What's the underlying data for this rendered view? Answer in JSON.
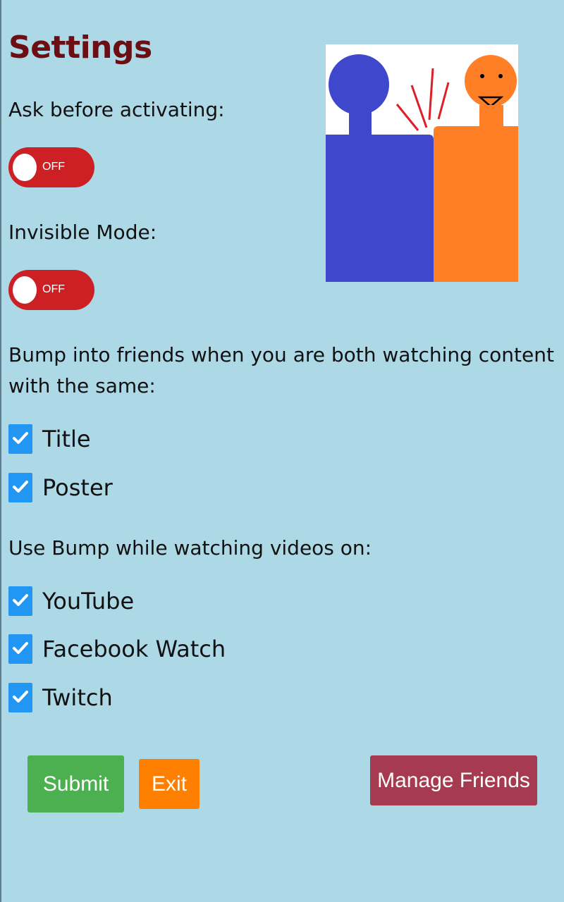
{
  "page": {
    "title": "Settings"
  },
  "settings": {
    "ask_before_activating": {
      "label": "Ask before activating:",
      "state": "OFF"
    },
    "invisible_mode": {
      "label": "Invisible Mode:",
      "state": "OFF"
    },
    "bump_match": {
      "label": "Bump into friends when you are both watching content with the same:",
      "options": [
        {
          "label": "Title",
          "checked": true
        },
        {
          "label": "Poster",
          "checked": true
        }
      ]
    },
    "platforms": {
      "label": "Use Bump while watching videos on:",
      "options": [
        {
          "label": "YouTube",
          "checked": true
        },
        {
          "label": "Facebook Watch",
          "checked": true
        },
        {
          "label": "Twitch",
          "checked": true
        }
      ]
    }
  },
  "buttons": {
    "submit": "Submit",
    "exit": "Exit",
    "manage_friends": "Manage Friends"
  },
  "colors": {
    "background": "#add8e6",
    "title": "#6b0f14",
    "toggle_off": "#cc2025",
    "checkbox": "#2196f3",
    "submit": "#4caf50",
    "exit": "#ff7f00",
    "manage_friends": "#a63a50",
    "figure_blue": "#3f48cc",
    "figure_orange": "#ff7f27"
  },
  "icons": {
    "illustration": "bump-illustration-icon",
    "checkmark": "checkmark-icon"
  }
}
